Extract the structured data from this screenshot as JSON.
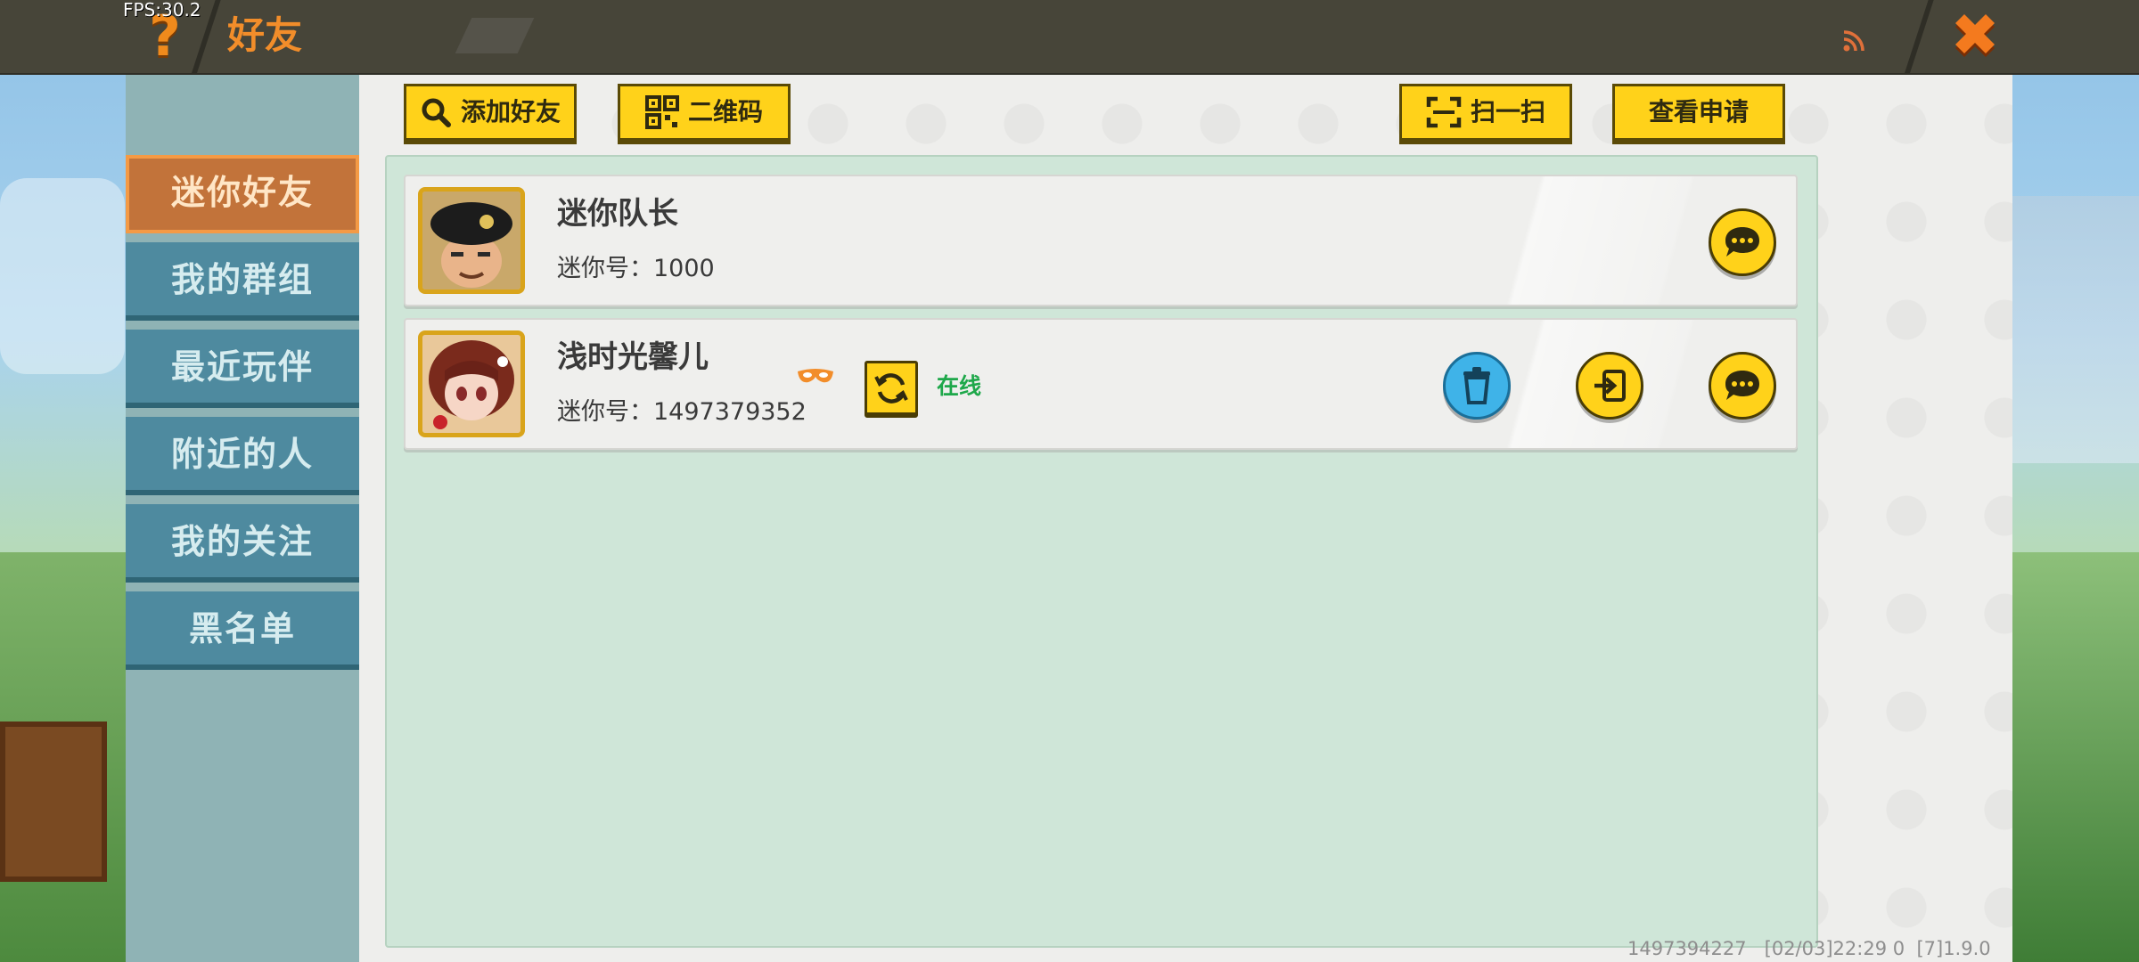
{
  "app": {
    "fps_label": "FPS:30.2",
    "title": "好友"
  },
  "sidebar": {
    "items": [
      {
        "label": "迷你好友",
        "active": true
      },
      {
        "label": "我的群组",
        "active": false
      },
      {
        "label": "最近玩伴",
        "active": false
      },
      {
        "label": "附近的人",
        "active": false
      },
      {
        "label": "我的关注",
        "active": false
      },
      {
        "label": "黑名单",
        "active": false
      }
    ]
  },
  "toolbar": {
    "add_friend": "添加好友",
    "qr_code": "二维码",
    "scan": "扫一扫",
    "view_requests": "查看申请"
  },
  "friends": [
    {
      "name": "迷你队长",
      "mini_id": "迷你号：1000"
    },
    {
      "name": "浅时光馨儿",
      "mini_id": "迷你号：1497379352",
      "status": "在线"
    }
  ],
  "footer": {
    "info": "1497394227   [02/03]22:29 0  [7]1.9.0"
  },
  "colors": {
    "accent": "#f28d2a",
    "button_yellow": "#ffd21a",
    "sidebar_item": "#4e8a9f",
    "sidebar_active": "#c2733a",
    "online_green": "#1ea84a",
    "list_bg": "#cfe6d8"
  }
}
